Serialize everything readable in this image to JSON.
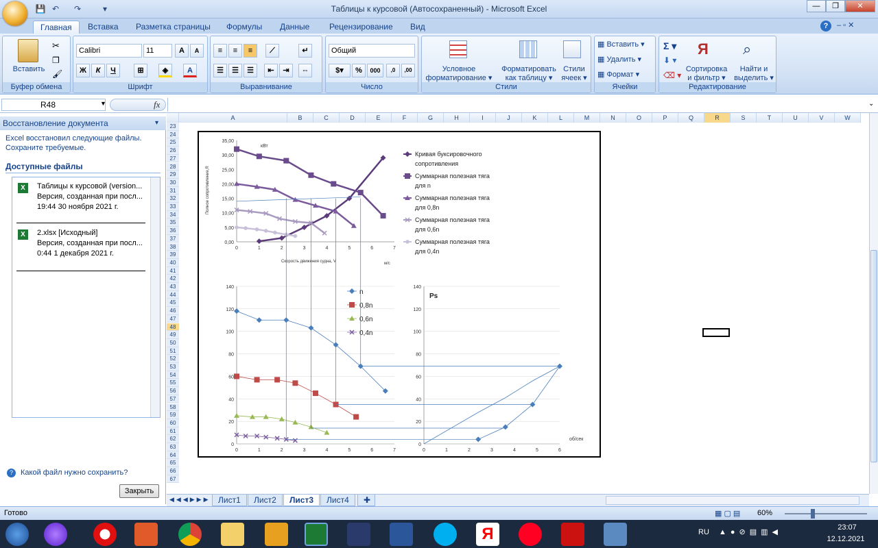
{
  "window": {
    "title": "Таблицы к курсовой (Автосохраненный) - Microsoft Excel",
    "minimize": "—",
    "restore": "❐",
    "close": "✕"
  },
  "ribbon_tabs": [
    "Главная",
    "Вставка",
    "Разметка страницы",
    "Формулы",
    "Данные",
    "Рецензирование",
    "Вид"
  ],
  "ribbon": {
    "paste": "Вставить",
    "clipboard": "Буфер обмена",
    "font_name": "Calibri",
    "font_size": "11",
    "font_group": "Шрифт",
    "bold": "Ж",
    "italic": "К",
    "underline": "Ч",
    "alignment_group": "Выравнивание",
    "number_format": "Общий",
    "number_group": "Число",
    "cond_format_1": "Условное",
    "cond_format_2": "форматирование",
    "format_table_1": "Форматировать",
    "format_table_2": "как таблицу",
    "cell_styles_1": "Стили",
    "cell_styles_2": "ячеек",
    "styles_group": "Стили",
    "insert": "Вставить",
    "delete": "Удалить",
    "format": "Формат",
    "cells_group": "Ячейки",
    "sort_1": "Сортировка",
    "sort_2": "и фильтр",
    "find_1": "Найти и",
    "find_2": "выделить",
    "editing_group": "Редактирование"
  },
  "formula_bar": {
    "name_box": "R48",
    "fx": "fx",
    "formula": ""
  },
  "recovery_pane": {
    "title": "Восстановление документа",
    "message": "Excel восстановил следующие файлы. Сохраните требуемые.",
    "available": "Доступные файлы",
    "files": [
      {
        "name": "Таблицы к курсовой (version...",
        "desc": "Версия, созданная при посл...",
        "time": "19:44 30 ноября 2021 г."
      },
      {
        "name": "2.xlsx  [Исходный]",
        "desc": "Версия, созданная при посл...",
        "time": "0:44 1 декабря 2021 г."
      }
    ],
    "help": "Какой файл нужно сохранить?",
    "close": "Закрыть"
  },
  "columns": [
    "A",
    "B",
    "C",
    "D",
    "E",
    "F",
    "G",
    "H",
    "I",
    "J",
    "K",
    "L",
    "M",
    "N",
    "O",
    "P",
    "Q",
    "R",
    "S",
    "T",
    "U",
    "V",
    "W"
  ],
  "rows": [
    23,
    24,
    25,
    26,
    27,
    28,
    29,
    30,
    31,
    32,
    33,
    34,
    35,
    36,
    37,
    38,
    39,
    40,
    41,
    42,
    43,
    44,
    45,
    46,
    47,
    48,
    49,
    50,
    51,
    52,
    53,
    54,
    55,
    56,
    57,
    58,
    59,
    60,
    61,
    62,
    63,
    64,
    65,
    66,
    67
  ],
  "sheet_tabs": [
    "Лист1",
    "Лист2",
    "Лист3",
    "Лист4"
  ],
  "active_sheet": "Лист3",
  "status": {
    "ready": "Готово",
    "zoom": "60%"
  },
  "taskbar": {
    "lang": "RU",
    "time": "23:07",
    "date": "12.12.2021"
  },
  "chart_data": [
    {
      "type": "line",
      "title": "",
      "ylabel": "Полное сопротивление,R",
      "unit_label": "кВт",
      "xlabel": "Скорость движения судна, V",
      "xunit": "м/с",
      "ylim": [
        0,
        35
      ],
      "xlim": [
        0,
        7
      ],
      "yticks": [
        "0,00",
        "5,00",
        "10,00",
        "15,00",
        "20,00",
        "25,00",
        "30,00",
        "35,00"
      ],
      "xticks": [
        "0",
        "1",
        "2",
        "3",
        "4",
        "5",
        "6",
        "7"
      ],
      "series": [
        {
          "name": "Кривая буксировочного сопротивления",
          "x": [
            1,
            2,
            3,
            4,
            5,
            6.5
          ],
          "y": [
            0.2,
            1.3,
            5,
            9,
            15,
            29
          ]
        },
        {
          "name": "Суммарная полезная тяга для n",
          "x": [
            0,
            1,
            2.2,
            3.3,
            4.3,
            5.5,
            6.5
          ],
          "y": [
            32,
            29.5,
            28,
            23,
            20,
            17,
            9
          ]
        },
        {
          "name": "Суммарная полезная тяга для 0,8n",
          "x": [
            0,
            0.9,
            1.7,
            2.6,
            3.5,
            4.4,
            5.2
          ],
          "y": [
            20,
            19,
            18,
            14.5,
            12.5,
            10.5,
            5.5
          ]
        },
        {
          "name": "Суммарная полезная тяга для 0,6n",
          "x": [
            0,
            0.6,
            1.3,
            1.9,
            2.6,
            3.3,
            3.9
          ],
          "y": [
            11,
            10.5,
            9.8,
            8,
            7,
            6.5,
            3
          ]
        },
        {
          "name": "Суммарная полезная тяга для 0,4n",
          "x": [
            0,
            0.4,
            0.9,
            1.3,
            1.7,
            2.2,
            2.6
          ],
          "y": [
            5,
            4.7,
            4.3,
            3.8,
            3.2,
            2.5,
            2
          ]
        }
      ]
    },
    {
      "type": "line",
      "title": "",
      "ylim": [
        0,
        140
      ],
      "xlim": [
        0,
        7
      ],
      "yticks": [
        "0",
        "20",
        "40",
        "60",
        "80",
        "100",
        "120",
        "140"
      ],
      "xticks": [
        "0",
        "1",
        "2",
        "3",
        "4",
        "5",
        "6",
        "7"
      ],
      "series": [
        {
          "name": "n",
          "x": [
            0,
            1,
            2.2,
            3.3,
            4.4,
            5.5,
            6.6
          ],
          "y": [
            118,
            110,
            110,
            103,
            88,
            69,
            47
          ]
        },
        {
          "name": "0,8n",
          "x": [
            0,
            0.9,
            1.8,
            2.6,
            3.5,
            4.4,
            5.3
          ],
          "y": [
            60,
            57,
            57,
            54,
            45,
            35,
            24
          ]
        },
        {
          "name": "0,6n",
          "x": [
            0,
            0.7,
            1.3,
            2,
            2.6,
            3.3,
            4
          ],
          "y": [
            25,
            24,
            24,
            22,
            19,
            15,
            10
          ]
        },
        {
          "name": "0,4n",
          "x": [
            0,
            0.4,
            0.9,
            1.3,
            1.8,
            2.2,
            2.6
          ],
          "y": [
            8,
            7,
            7,
            6,
            5,
            4,
            3
          ]
        }
      ]
    },
    {
      "type": "line",
      "title": "Ps",
      "xunit": "об/сек",
      "ylim": [
        0,
        140
      ],
      "xlim": [
        0,
        6
      ],
      "yticks": [
        "0",
        "20",
        "40",
        "60",
        "80",
        "100",
        "120",
        "140"
      ],
      "xticks": [
        "0",
        "1",
        "2",
        "3",
        "4",
        "5",
        "6"
      ],
      "series": [
        {
          "name": "",
          "x": [
            0,
            2.4,
            3.6,
            4.8,
            6
          ],
          "y": [
            0,
            28,
            41,
            56,
            69
          ]
        },
        {
          "name": "",
          "x": [
            2.4,
            3.6,
            4.8,
            6
          ],
          "y": [
            4,
            15,
            35,
            69
          ]
        }
      ]
    }
  ]
}
